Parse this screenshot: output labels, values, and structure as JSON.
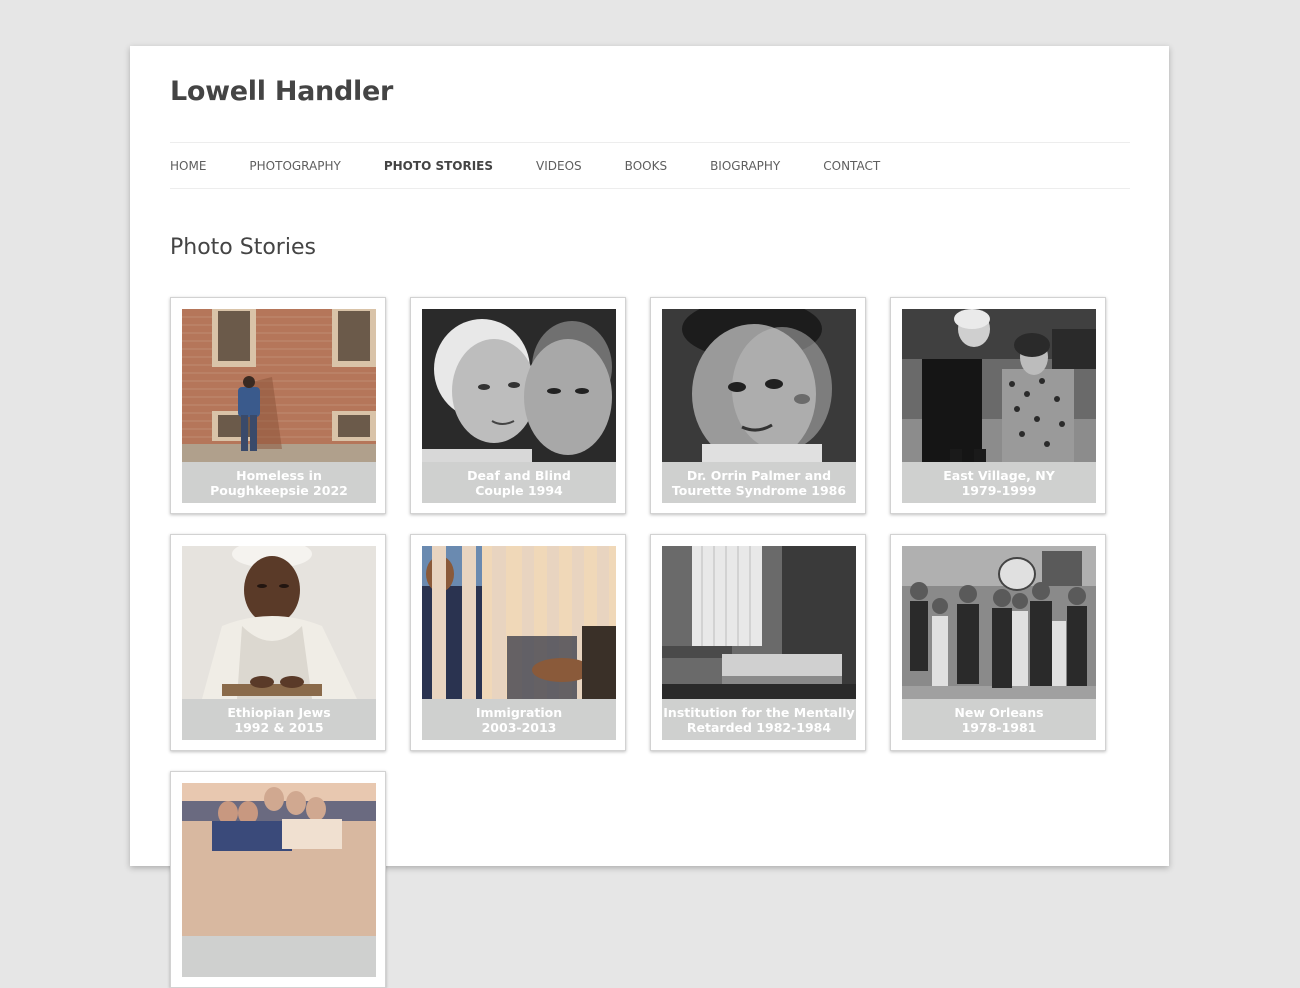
{
  "site": {
    "title": "Lowell Handler"
  },
  "nav": {
    "items": [
      {
        "label": "HOME"
      },
      {
        "label": "PHOTOGRAPHY"
      },
      {
        "label": "PHOTO STORIES"
      },
      {
        "label": "VIDEOS"
      },
      {
        "label": "BOOKS"
      },
      {
        "label": "BIOGRAPHY"
      },
      {
        "label": "CONTACT"
      }
    ],
    "active_index": 2
  },
  "main": {
    "title": "Photo Stories",
    "stories": [
      {
        "line1": "Homeless in",
        "line2": "Poughkeepsie 2022"
      },
      {
        "line1": "Deaf and Blind",
        "line2": "Couple 1994"
      },
      {
        "line1": "Dr. Orrin Palmer and",
        "line2": "Tourette Syndrome 1986"
      },
      {
        "line1": "East Village, NY",
        "line2": "1979-1999"
      },
      {
        "line1": "Ethiopian Jews",
        "line2": "1992 & 2015"
      },
      {
        "line1": "Immigration",
        "line2": "2003-2013"
      },
      {
        "line1": "Institution for the Mentally",
        "line2": "Retarded 1982-1984"
      },
      {
        "line1": "New Orleans",
        "line2": "1978-1981"
      },
      {
        "line1": "",
        "line2": ""
      }
    ]
  }
}
